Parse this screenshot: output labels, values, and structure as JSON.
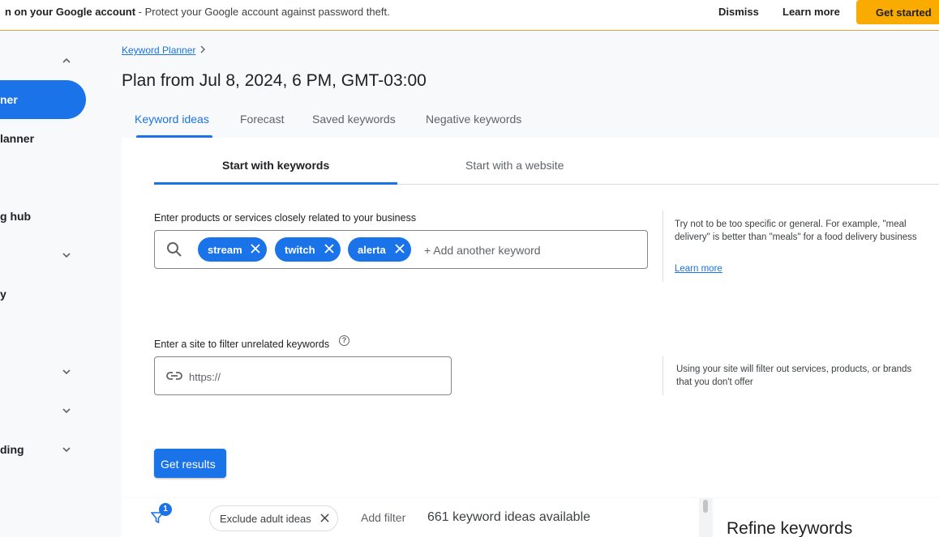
{
  "banner": {
    "message_bold": "n on your Google account",
    "message_rest": " - Protect your Google account against password theft.",
    "dismiss": "Dismiss",
    "learn_more": "Learn more",
    "get_started": "Get started"
  },
  "sidebar": {
    "items": [
      {
        "label": "ner",
        "active": true
      },
      {
        "label": "lanner"
      },
      {
        "label": "g hub"
      },
      {
        "label": "y"
      },
      {
        "label": "ding"
      }
    ]
  },
  "breadcrumb": "Keyword Planner",
  "title": "Plan from Jul 8, 2024, 6 PM, GMT-03:00",
  "tabs": [
    "Keyword ideas",
    "Forecast",
    "Saved keywords",
    "Negative keywords"
  ],
  "subtabs": [
    "Start with keywords",
    "Start with a website"
  ],
  "keywords": {
    "label": "Enter products or services closely related to your business",
    "chips": [
      "stream",
      "twitch",
      "alerta"
    ],
    "placeholder": "+ Add another keyword",
    "tip": "Try not to be too specific or general. For example, \"meal delivery\" is better than \"meals\" for a food delivery business",
    "tip_link": "Learn more"
  },
  "site": {
    "label": "Enter a site to filter unrelated keywords",
    "placeholder": "https://",
    "tip": "Using your site will filter out services, products, or brands that you don't offer"
  },
  "get_results": "Get results",
  "bottom": {
    "filter_count": "1",
    "exclude_chip": "Exclude adult ideas",
    "add_filter": "Add filter",
    "ideas_count": "661 keyword ideas available"
  },
  "refine": "Refine keywords"
}
